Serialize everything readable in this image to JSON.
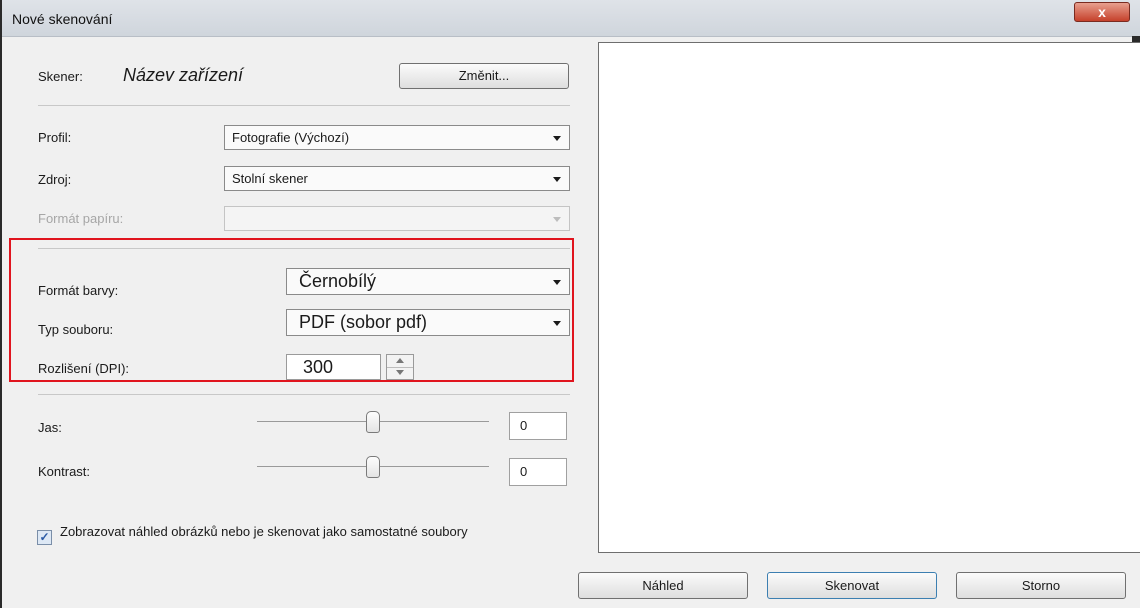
{
  "window": {
    "title": "Nové skenování",
    "close_label": "x"
  },
  "scanner": {
    "label": "Skener:",
    "device_name": "Název zařízení",
    "change_button": "Změnit..."
  },
  "fields": {
    "profile": {
      "label": "Profil:",
      "value": "Fotografie (Výchozí)"
    },
    "source": {
      "label": "Zdroj:",
      "value": "Stolní skener"
    },
    "paper": {
      "label": "Formát papíru:",
      "value": ""
    },
    "color": {
      "label": "Formát barvy:",
      "value": "Černobílý"
    },
    "filetype": {
      "label": "Typ souboru:",
      "value": "PDF (sobor pdf)"
    },
    "dpi": {
      "label": "Rozlišení (DPI):",
      "value": "300"
    }
  },
  "adjustments": {
    "brightness": {
      "label": "Jas:",
      "value": "0",
      "level": 0.5
    },
    "contrast": {
      "label": "Kontrast:",
      "value": "0",
      "level": 0.5
    }
  },
  "checkbox": {
    "checked": true,
    "label": "Zobrazovat náhled obrázků nebo je skenovat jako samostatné soubory"
  },
  "buttons": {
    "preview": "Náhled",
    "scan": "Skenovat",
    "cancel": "Storno"
  },
  "colors": {
    "highlight": "#e0141e",
    "close": "#c5412b"
  }
}
